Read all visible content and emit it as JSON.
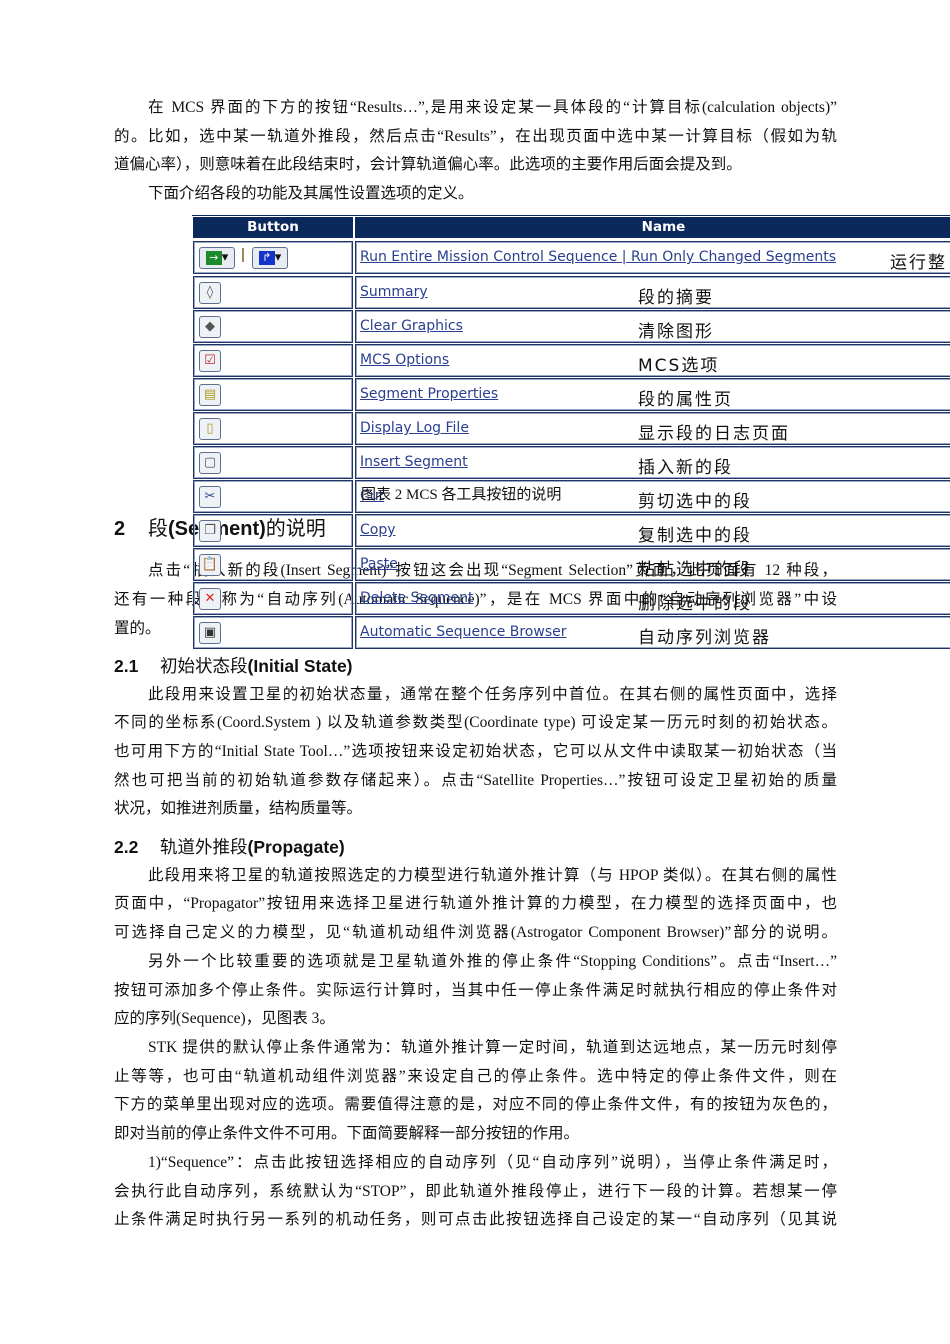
{
  "intro": [
    "在 MCS 界面的下方的按钮“Results…”,是用来设定某一具体段的“计算目标(calculation objects)”",
    "的。比如，选中某一轨道外推段，然后点击“Results”，在出现页面中选中某一计算目标（假如为轨",
    "道偏心率），则意味着在此段结束时，会计算轨道偏心率。此选项的主要作用后面会提及到。",
    "下面介绍各段的功能及其属性设置选项的定义。"
  ],
  "table": {
    "header_button": "Button",
    "header_name": "Name",
    "run_row": {
      "link": "Run Entire Mission Control Sequence | Run Only Changed Segments",
      "cn": "运行整"
    },
    "rows": [
      {
        "icon": "summary-icon",
        "glyph": "◊",
        "link": "Summary",
        "cn": "段的摘要"
      },
      {
        "icon": "clear-graphics-icon",
        "glyph": "◆",
        "link": "Clear Graphics",
        "cn": "清除图形"
      },
      {
        "icon": "mcs-options-icon",
        "glyph": "☑",
        "link": "MCS Options",
        "cn": "MCS选项"
      },
      {
        "icon": "segment-properties-icon",
        "glyph": "▤",
        "link": "Segment Properties",
        "cn": "段的属性页"
      },
      {
        "icon": "display-log-icon",
        "glyph": "▯",
        "link": "Display Log File",
        "cn": "显示段的日志页面"
      },
      {
        "icon": "insert-segment-icon",
        "glyph": "▢",
        "link": "Insert Segment",
        "cn": "插入新的段"
      },
      {
        "icon": "cut-icon",
        "glyph": "✂",
        "link": "Cut",
        "cn": "剪切选中的段"
      },
      {
        "icon": "copy-icon",
        "glyph": "❐",
        "link": "Copy",
        "cn": "复制选中的段"
      },
      {
        "icon": "paste-icon",
        "glyph": "📋",
        "link": "Paste",
        "cn": "粘帖选中的段"
      },
      {
        "icon": "delete-icon",
        "glyph": "✕",
        "link": "Delete Segment",
        "cn": "删除选中的段"
      },
      {
        "icon": "sequence-browser-icon",
        "glyph": "▣",
        "link": "Automatic Sequence Browser",
        "cn": "自动序列浏览器"
      }
    ],
    "caption": "图表 2 MCS 各工具按钮的说明"
  },
  "section2": {
    "num": "2",
    "title_pre": "段",
    "title_bold": "(Segment)",
    "title_post": "的说明",
    "lines": [
      "点击“插入新的段(Insert Segment)”按钮这会出现“Segment Selection”页面，此页面有 12 种段，",
      "还有一种段，称为“自动序列(Automatic Sequence)”，是在 MCS 界面中的“自动序列浏览器”中设",
      "置的。"
    ]
  },
  "section21": {
    "num": "2.1",
    "title_pre": "初始状态段",
    "title_bold": "(Initial State)",
    "lines": [
      "此段用来设置卫星的初始状态量，通常在整个任务序列中首位。在其右侧的属性页面中，选择",
      "不同的坐标系(Coord.System ) 以及轨道参数类型(Coordinate type) 可设定某一历元时刻的初始状态。",
      "也可用下方的“Initial State Tool…”选项按钮来设定初始状态，它可以从文件中读取某一初始状态（当",
      "然也可把当前的初始轨道参数存储起来）。点击“Satellite Properties…”按钮可设定卫星初始的质量",
      "状况，如推进剂质量，结构质量等。"
    ]
  },
  "section22": {
    "num": "2.2",
    "title_pre": "轨道外推段",
    "title_bold": "(Propagate)",
    "lines": [
      "此段用来将卫星的轨道按照选定的力模型进行轨道外推计算（与 HPOP 类似）。在其右侧的属性",
      "页面中，“Propagator”按钮用来选择卫星进行轨道外推计算的力模型，在力模型的选择页面中，也",
      "可选择自己定义的力模型，见“轨道机动组件浏览器(Astrogator Component Browser)”部分的说明。",
      "另外一个比较重要的选项就是卫星轨道外推的停止条件“Stopping Conditions”。点击“Insert…”",
      "按钮可添加多个停止条件。实际运行计算时，当其中任一停止条件满足时就执行相应的停止条件对",
      "应的序列(Sequence)，见图表 3。",
      "STK 提供的默认停止条件通常为：轨道外推计算一定时间，轨道到达远地点，某一历元时刻停",
      "止等等，也可由“轨道机动组件浏览器”来设定自己的停止条件。选中特定的停止条件文件，则在",
      "下方的菜单里出现对应的选项。需要值得注意的是，对应不同的停止条件文件，有的按钮为灰色的，",
      "即对当前的停止条件文件不可用。下面简要解释一部分按钮的作用。",
      "1)“Sequence”：点击此按钮选择相应的自动序列（见“自动序列”说明），当停止条件满足时，",
      "会执行此自动序列，系统默认为“STOP”，即此轨道外推段停止，进行下一段的计算。若想某一停",
      "止条件满足时执行另一系列的机动任务，则可点击此按钮选择自己设定的某一“自动序列（见其说"
    ]
  }
}
